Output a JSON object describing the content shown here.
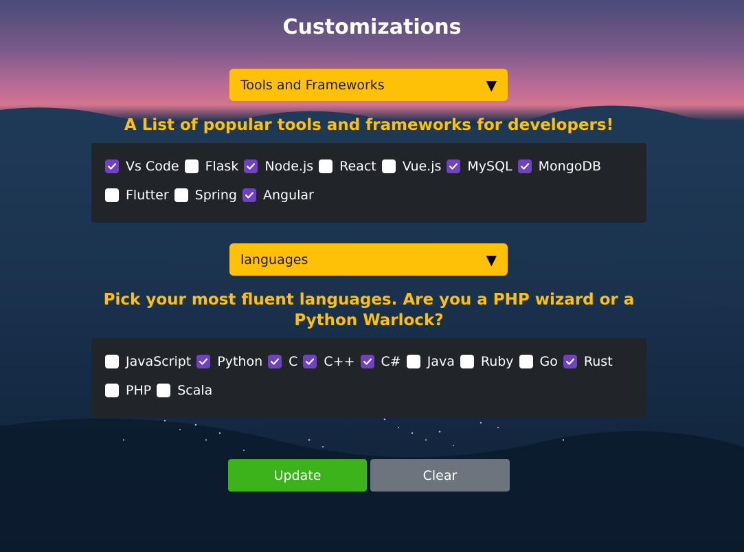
{
  "page": {
    "title": "Customizations"
  },
  "tools_section": {
    "dropdown_label": "Tools and Frameworks",
    "heading": "A List of popular tools and frameworks for developers!",
    "options": [
      {
        "label": "Vs Code",
        "checked": true
      },
      {
        "label": "Flask",
        "checked": false
      },
      {
        "label": "Node.js",
        "checked": true
      },
      {
        "label": "React",
        "checked": false
      },
      {
        "label": "Vue.js",
        "checked": false
      },
      {
        "label": "MySQL",
        "checked": true
      },
      {
        "label": "MongoDB",
        "checked": true
      },
      {
        "label": "Flutter",
        "checked": false
      },
      {
        "label": "Spring",
        "checked": false
      },
      {
        "label": "Angular",
        "checked": true
      }
    ]
  },
  "languages_section": {
    "dropdown_label": "languages",
    "heading": "Pick your most fluent languages. Are you a PHP wizard or a Python Warlock?",
    "options": [
      {
        "label": "JavaScript",
        "checked": false
      },
      {
        "label": "Python",
        "checked": true
      },
      {
        "label": "C",
        "checked": true
      },
      {
        "label": "C++",
        "checked": true
      },
      {
        "label": "C#",
        "checked": true
      },
      {
        "label": "Java",
        "checked": false
      },
      {
        "label": "Ruby",
        "checked": false
      },
      {
        "label": "Go",
        "checked": false
      },
      {
        "label": "Rust",
        "checked": true
      },
      {
        "label": "PHP",
        "checked": false
      },
      {
        "label": "Scala",
        "checked": false
      }
    ]
  },
  "actions": {
    "update_label": "Update",
    "clear_label": "Clear"
  },
  "colors": {
    "accent_yellow": "#ffc107",
    "panel_dark": "#212529",
    "checkbox_checked": "#6f42c1",
    "update_green": "#3cb21b",
    "clear_gray": "#6c757d"
  },
  "icons": {
    "dropdown_arrow": "caret-down-icon",
    "checkbox_check": "check-icon"
  }
}
